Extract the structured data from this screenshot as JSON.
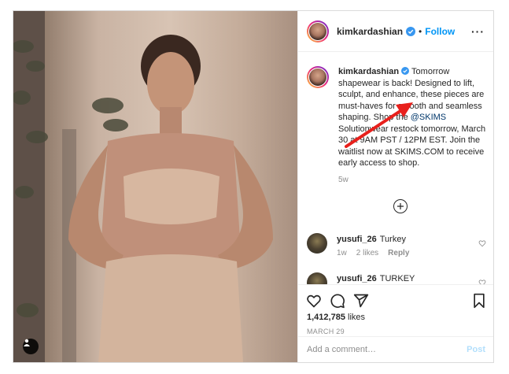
{
  "header": {
    "username": "kimkardashian",
    "dot": "•",
    "follow_label": "Follow",
    "more_icon": "more-icon"
  },
  "caption": {
    "username": "kimkardashian",
    "text_before": "Tomorrow shapewear is back! Designed to lift, sculpt, and enhance, these pieces are must-haves for smooth and seamless shaping. Shop the ",
    "mention": "@SKIMS",
    "text_after": " Solutionwear restock tomorrow, March 30 at 9AM PST / 12PM EST. Join the waitlist now at SKIMS.COM to receive early access to shop.",
    "age": "5w"
  },
  "comments": [
    {
      "username": "yusufi_26",
      "text": "Turkey",
      "age": "1w",
      "likes": "2 likes",
      "reply": "Reply"
    },
    {
      "username": "yusufi_26",
      "text": "TURKEY",
      "age": "",
      "likes": "",
      "reply": ""
    }
  ],
  "stats": {
    "likes_count": "1,412,785",
    "likes_word": "likes",
    "date": "MARCH 29"
  },
  "add_comment": {
    "placeholder": "Add a comment…",
    "post_label": "Post"
  },
  "colors": {
    "accent": "#0095f6",
    "annotation_arrow": "#e8201c"
  }
}
